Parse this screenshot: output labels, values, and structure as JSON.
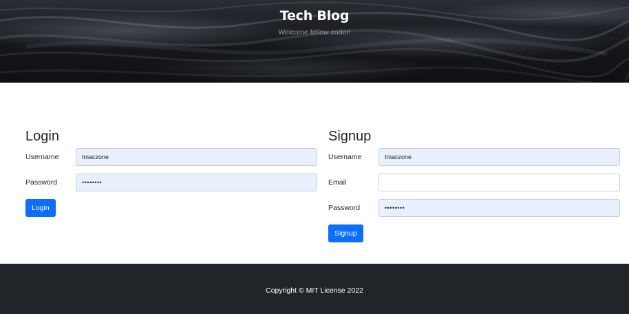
{
  "header": {
    "title": "Tech Blog",
    "subtitle": "Welcome fellow coder!"
  },
  "login": {
    "heading": "Login",
    "username_label": "Username",
    "username_value": "tmaczone",
    "password_label": "Password",
    "password_value": "tmaczone",
    "submit_label": "Login"
  },
  "signup": {
    "heading": "Signup",
    "username_label": "Username",
    "username_value": "tmaczone",
    "email_label": "Email",
    "email_value": "",
    "password_label": "Password",
    "password_value": "tmaczone",
    "submit_label": "Signup"
  },
  "footer": {
    "copyright": "Copyright © MIT License 2022"
  },
  "colors": {
    "primary": "#0d6efd",
    "footer_bg": "#212529",
    "autofill_bg": "#e8f0fe"
  }
}
